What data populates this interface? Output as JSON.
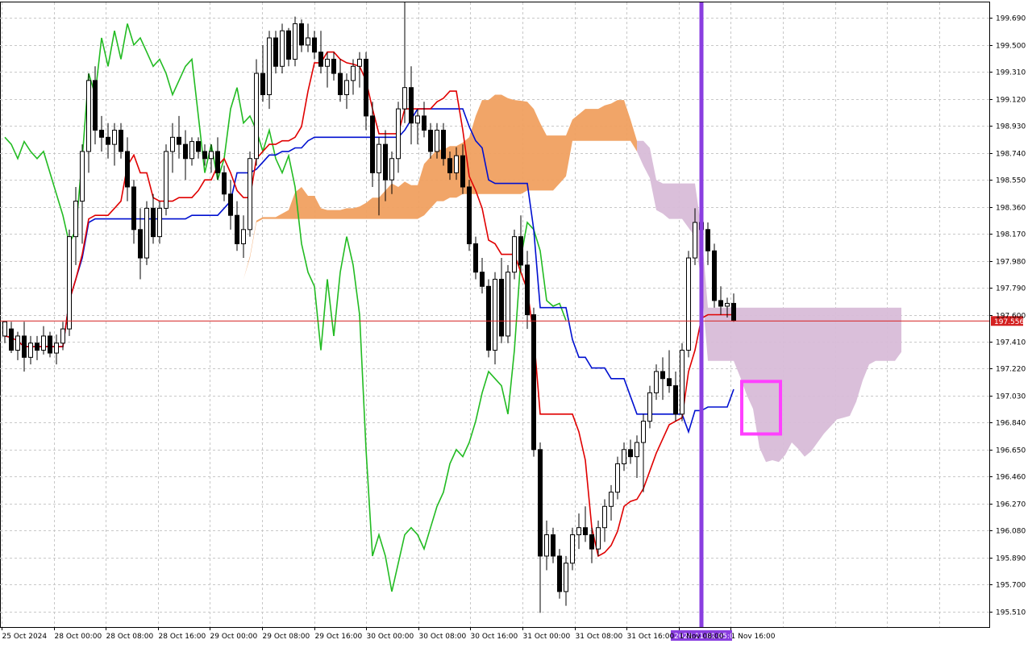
{
  "chart_data": {
    "type": "candlestick",
    "title": "",
    "y_range": [
      195.4,
      199.8
    ],
    "y_ticks": [
      "199.690",
      "199.500",
      "199.310",
      "199.120",
      "198.930",
      "198.740",
      "198.550",
      "198.360",
      "198.170",
      "197.980",
      "197.790",
      "197.600",
      "197.410",
      "197.220",
      "197.030",
      "196.840",
      "196.650",
      "196.460",
      "196.270",
      "196.080",
      "195.890",
      "195.700",
      "195.510"
    ],
    "x_ticks": [
      "25 Oct 2024",
      "28 Oct 00:00",
      "28 Oct 08:00",
      "28 Oct 16:00",
      "29 Oct 00:00",
      "29 Oct 08:00",
      "29 Oct 16:00",
      "30 Oct 00:00",
      "30 Oct 08:00",
      "30 Oct 16:00",
      "31 Oct 00:00",
      "31 Oct 08:00",
      "31 Oct 16:00",
      "1 Nov 08:00",
      "1 Nov 16:00"
    ],
    "current_price": {
      "label": "197.556",
      "value": 197.556,
      "color": "#d42020"
    },
    "crosshair_label": "2024.11.01 05:00",
    "colors": {
      "bull": "#ffffff",
      "bear": "#000000",
      "tenkan": "#e00000",
      "kijun": "#0010d0",
      "chikou": "#22bb22",
      "cloud_bull": "#f0a060",
      "cloud_bear": "#d8bcd8",
      "vline": "#8a3ee0",
      "highlight": "#ff40ff",
      "grid": "#c8c8c8"
    },
    "candles": [
      [
        197.45,
        197.5,
        197.4,
        197.55
      ],
      [
        197.5,
        197.55,
        197.33,
        197.35
      ],
      [
        197.35,
        197.48,
        197.28,
        197.45
      ],
      [
        197.45,
        197.55,
        197.2,
        197.3
      ],
      [
        197.3,
        197.45,
        197.25,
        197.4
      ],
      [
        197.4,
        197.45,
        197.28,
        197.35
      ],
      [
        197.35,
        197.52,
        197.32,
        197.45
      ],
      [
        197.45,
        197.48,
        197.3,
        197.33
      ],
      [
        197.33,
        197.46,
        197.25,
        197.4
      ],
      [
        197.4,
        197.55,
        197.35,
        197.5
      ],
      [
        197.5,
        198.2,
        197.45,
        198.15
      ],
      [
        198.15,
        198.5,
        197.95,
        198.4
      ],
      [
        198.4,
        198.8,
        198.1,
        198.75
      ],
      [
        198.75,
        199.3,
        198.6,
        199.25
      ],
      [
        199.25,
        199.35,
        198.8,
        198.9
      ],
      [
        198.9,
        199.0,
        198.75,
        198.85
      ],
      [
        198.85,
        198.95,
        198.7,
        198.8
      ],
      [
        198.8,
        198.95,
        198.65,
        198.9
      ],
      [
        198.9,
        198.95,
        198.7,
        198.75
      ],
      [
        198.75,
        198.85,
        198.4,
        198.5
      ],
      [
        198.5,
        198.55,
        198.1,
        198.2
      ],
      [
        198.2,
        198.35,
        197.85,
        198.0
      ],
      [
        198.0,
        198.4,
        197.95,
        198.35
      ],
      [
        198.35,
        198.45,
        198.1,
        198.15
      ],
      [
        198.15,
        198.4,
        198.1,
        198.35
      ],
      [
        198.35,
        198.8,
        198.3,
        198.75
      ],
      [
        198.75,
        198.95,
        198.6,
        198.85
      ],
      [
        198.85,
        199.0,
        198.7,
        198.8
      ],
      [
        198.8,
        198.9,
        198.55,
        198.7
      ],
      [
        198.7,
        198.85,
        198.65,
        198.82
      ],
      [
        198.82,
        198.85,
        198.7,
        198.75
      ],
      [
        198.75,
        198.8,
        198.65,
        198.7
      ],
      [
        198.7,
        198.8,
        198.6,
        198.75
      ],
      [
        198.75,
        198.85,
        198.55,
        198.6
      ],
      [
        198.6,
        198.65,
        198.4,
        198.45
      ],
      [
        198.45,
        198.55,
        198.2,
        198.3
      ],
      [
        198.3,
        198.4,
        198.05,
        198.1
      ],
      [
        198.1,
        198.3,
        198.0,
        198.2
      ],
      [
        198.2,
        198.75,
        198.15,
        198.7
      ],
      [
        198.7,
        199.4,
        198.65,
        199.3
      ],
      [
        199.3,
        199.5,
        199.1,
        199.15
      ],
      [
        199.15,
        199.6,
        199.05,
        199.55
      ],
      [
        199.55,
        199.6,
        199.3,
        199.35
      ],
      [
        199.35,
        199.65,
        199.3,
        199.6
      ],
      [
        199.6,
        199.62,
        199.35,
        199.4
      ],
      [
        199.4,
        199.7,
        199.35,
        199.65
      ],
      [
        199.65,
        199.68,
        199.45,
        199.5
      ],
      [
        199.5,
        199.65,
        199.45,
        199.55
      ],
      [
        199.55,
        199.6,
        199.4,
        199.45
      ],
      [
        199.45,
        199.6,
        199.3,
        199.35
      ],
      [
        199.35,
        199.45,
        199.2,
        199.4
      ],
      [
        199.4,
        199.45,
        199.25,
        199.3
      ],
      [
        199.3,
        199.4,
        199.1,
        199.15
      ],
      [
        199.15,
        199.3,
        199.05,
        199.25
      ],
      [
        199.25,
        199.4,
        199.15,
        199.35
      ],
      [
        199.35,
        199.45,
        199.2,
        199.4
      ],
      [
        199.4,
        199.45,
        198.9,
        199.0
      ],
      [
        199.0,
        199.1,
        198.5,
        198.6
      ],
      [
        198.6,
        198.85,
        198.3,
        198.8
      ],
      [
        198.8,
        198.9,
        198.4,
        198.55
      ],
      [
        198.55,
        198.75,
        198.45,
        198.7
      ],
      [
        198.7,
        199.1,
        198.6,
        199.05
      ],
      [
        199.05,
        199.8,
        198.95,
        199.2
      ],
      [
        199.2,
        199.35,
        198.8,
        198.95
      ],
      [
        198.95,
        199.05,
        198.8,
        199.0
      ],
      [
        199.0,
        199.1,
        198.85,
        198.9
      ],
      [
        198.9,
        198.95,
        198.7,
        198.75
      ],
      [
        198.75,
        198.95,
        198.7,
        198.9
      ],
      [
        198.9,
        198.95,
        198.65,
        198.7
      ],
      [
        198.7,
        198.75,
        198.55,
        198.6
      ],
      [
        198.6,
        198.78,
        198.55,
        198.72
      ],
      [
        198.72,
        198.8,
        198.45,
        198.5
      ],
      [
        198.5,
        198.55,
        198.05,
        198.1
      ],
      [
        198.1,
        198.15,
        197.85,
        197.9
      ],
      [
        197.9,
        198.0,
        197.75,
        197.8
      ],
      [
        197.8,
        197.85,
        197.3,
        197.35
      ],
      [
        197.35,
        197.9,
        197.25,
        197.85
      ],
      [
        197.85,
        198.0,
        197.4,
        197.45
      ],
      [
        197.45,
        197.95,
        197.4,
        197.9
      ],
      [
        197.9,
        198.2,
        197.85,
        198.15
      ],
      [
        198.15,
        198.3,
        197.9,
        197.95
      ],
      [
        197.95,
        198.05,
        197.5,
        197.6
      ],
      [
        197.6,
        197.65,
        196.6,
        196.65
      ],
      [
        196.65,
        196.7,
        195.5,
        195.9
      ],
      [
        195.9,
        196.15,
        195.8,
        196.05
      ],
      [
        196.05,
        196.1,
        195.85,
        195.9
      ],
      [
        195.9,
        195.95,
        195.6,
        195.65
      ],
      [
        195.65,
        195.9,
        195.55,
        195.85
      ],
      [
        195.85,
        196.1,
        195.8,
        196.05
      ],
      [
        196.05,
        196.2,
        195.95,
        196.1
      ],
      [
        196.1,
        196.25,
        196.0,
        196.05
      ],
      [
        196.05,
        196.1,
        195.85,
        195.95
      ],
      [
        195.95,
        196.15,
        195.9,
        196.1
      ],
      [
        196.1,
        196.3,
        196.0,
        196.25
      ],
      [
        196.25,
        196.4,
        196.15,
        196.35
      ],
      [
        196.35,
        196.6,
        196.3,
        196.55
      ],
      [
        196.55,
        196.7,
        196.5,
        196.65
      ],
      [
        196.65,
        196.72,
        196.55,
        196.6
      ],
      [
        196.6,
        196.75,
        196.45,
        196.7
      ],
      [
        196.7,
        196.9,
        196.35,
        196.85
      ],
      [
        196.85,
        197.1,
        196.8,
        197.05
      ],
      [
        197.05,
        197.25,
        197.0,
        197.2
      ],
      [
        197.2,
        197.3,
        197.0,
        197.15
      ],
      [
        197.15,
        197.35,
        197.05,
        197.1
      ],
      [
        197.1,
        197.2,
        196.85,
        196.9
      ],
      [
        196.9,
        197.4,
        196.85,
        197.35
      ],
      [
        197.35,
        198.05,
        197.3,
        198.0
      ],
      [
        198.0,
        198.35,
        197.95,
        198.25
      ],
      [
        198.25,
        198.3,
        198.15,
        198.2
      ],
      [
        198.2,
        198.25,
        197.95,
        198.05
      ],
      [
        198.05,
        198.1,
        197.65,
        197.7
      ],
      [
        197.7,
        197.8,
        197.6,
        197.66
      ],
      [
        197.66,
        197.72,
        197.58,
        197.68
      ],
      [
        197.68,
        197.75,
        197.55,
        197.56
      ]
    ]
  }
}
